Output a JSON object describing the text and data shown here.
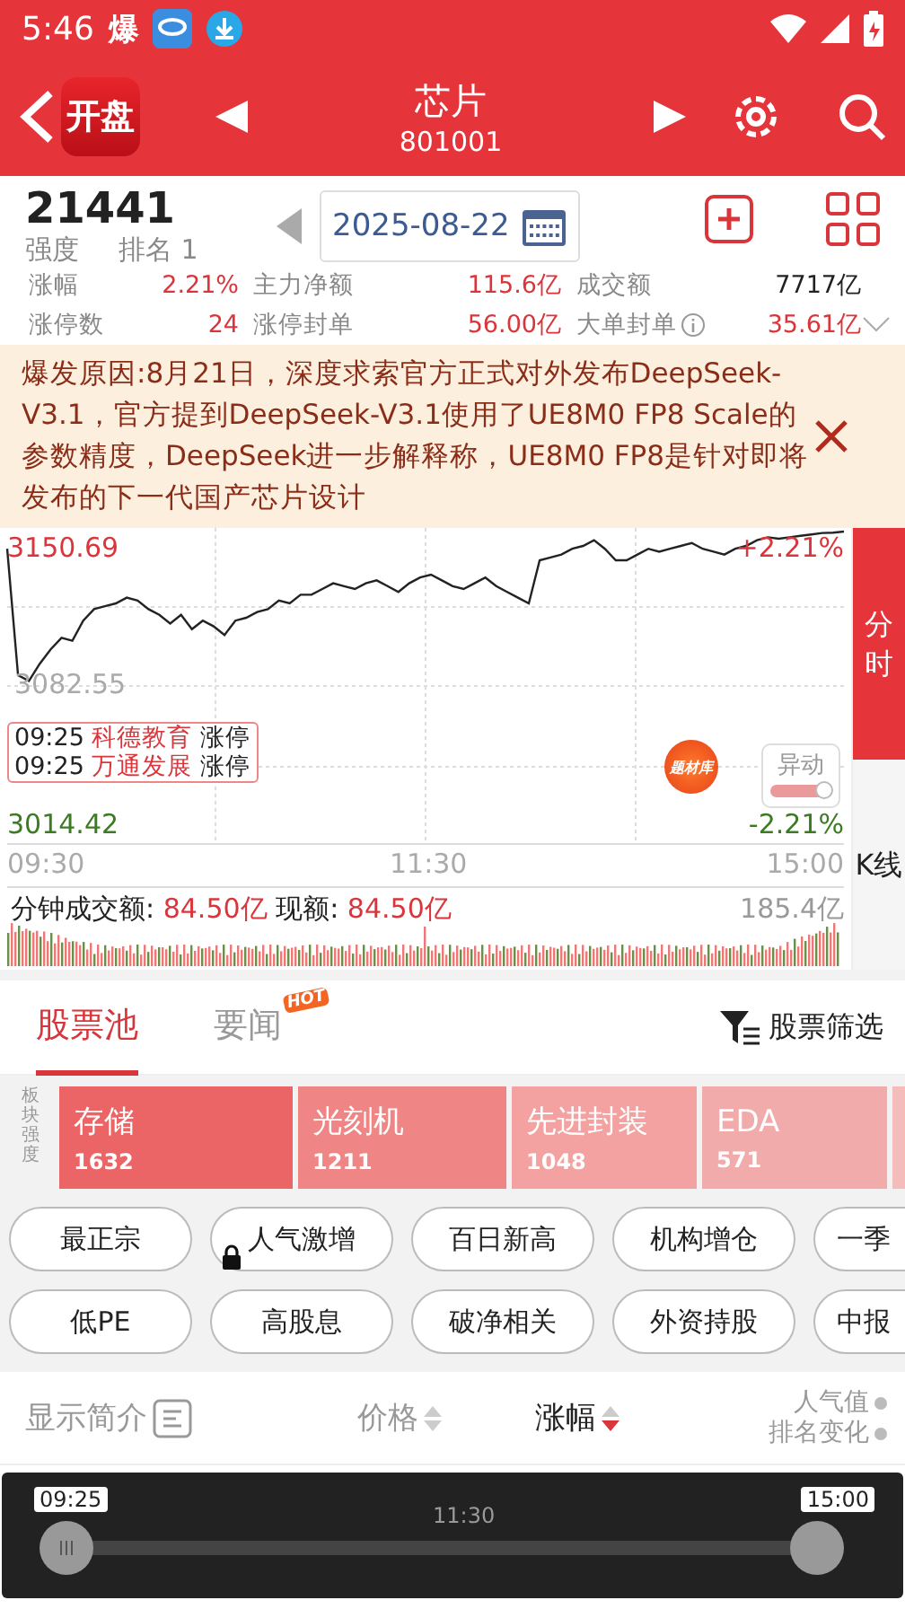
{
  "status_bar": {
    "time": "5:46",
    "app_mark": "爆"
  },
  "header": {
    "logo": "开盘",
    "title": "芯片",
    "code": "801001"
  },
  "summary": {
    "strength": "21441",
    "strength_label": "强度",
    "rank": "排名 1",
    "date": "2025-08-22"
  },
  "stats": [
    {
      "label": "涨幅",
      "value": "2.21%",
      "rising": true
    },
    {
      "label": "主力净额",
      "value": "115.6亿",
      "rising": true
    },
    {
      "label": "成交额",
      "value": "7717亿",
      "rising": false
    },
    {
      "label": "涨停数",
      "value": "24",
      "rising": true
    },
    {
      "label": "涨停封单",
      "value": "56.00亿",
      "rising": true
    },
    {
      "label": "大单封单",
      "value": "35.61亿",
      "rising": true,
      "info": true
    }
  ],
  "banner": {
    "text": "爆发原因:8月21日，深度求索官方正式对外发布DeepSeek-V3.1，官方提到DeepSeek-V3.1使用了UE8M0 FP8 Scale的参数精度，DeepSeek进一步解释称，UE8M0 FP8是针对即将发布的下一代国产芯片设计"
  },
  "chart": {
    "high": "3150.69",
    "mid": "3082.55",
    "low": "3014.42",
    "up_pct": "+2.21%",
    "down_pct": "-2.21%",
    "times": [
      "09:30",
      "11:30",
      "15:00"
    ],
    "events": [
      {
        "time": "09:25",
        "name": "科德教育",
        "action": "涨停"
      },
      {
        "time": "09:25",
        "name": "万通发展",
        "action": "涨停"
      }
    ],
    "theme_badge": "题材库",
    "alert_toggle": {
      "label": "异动",
      "on": true
    },
    "volume_label": "分钟成交额:",
    "volume_value": "84.50亿",
    "now_label": "现额:",
    "now_value": "84.50亿",
    "volume_max": "185.4亿"
  },
  "side_tabs": [
    {
      "label": "分时",
      "selected": true
    },
    {
      "label": "K线",
      "selected": false
    }
  ],
  "tabs": [
    {
      "label": "股票池",
      "selected": true
    },
    {
      "label": "要闻",
      "selected": false,
      "badge": "HOT"
    }
  ],
  "filter": "股票筛选",
  "sectors_label": "板块强度",
  "sectors": [
    {
      "name": "存储",
      "value": "1632",
      "color": "#ec6566"
    },
    {
      "name": "光刻机",
      "value": "1211",
      "color": "#ef8585"
    },
    {
      "name": "先进封装",
      "value": "1048",
      "color": "#f3a1a1"
    },
    {
      "name": "EDA",
      "value": "571",
      "color": "#f2abab"
    }
  ],
  "chip_rows": [
    [
      {
        "label": "最正宗",
        "locked": false
      },
      {
        "label": "人气激增",
        "locked": true
      },
      {
        "label": "百日新高",
        "locked": false
      },
      {
        "label": "机构增仓",
        "locked": false
      },
      {
        "label": "一季",
        "locked": false
      }
    ],
    [
      {
        "label": "低PE",
        "locked": false
      },
      {
        "label": "高股息",
        "locked": false
      },
      {
        "label": "破净相关",
        "locked": false
      },
      {
        "label": "外资持股",
        "locked": false
      },
      {
        "label": "中报",
        "locked": false
      }
    ]
  ],
  "list_header": {
    "intro": "显示简介",
    "columns": [
      {
        "label": "价格",
        "sorted": false
      },
      {
        "label": "涨幅",
        "sorted": true
      }
    ],
    "popularity": "人气值",
    "rank_change": "排名变化"
  },
  "timeline": {
    "start": "09:25",
    "mid": "11:30",
    "end": "15:00",
    "level": 1
  }
}
